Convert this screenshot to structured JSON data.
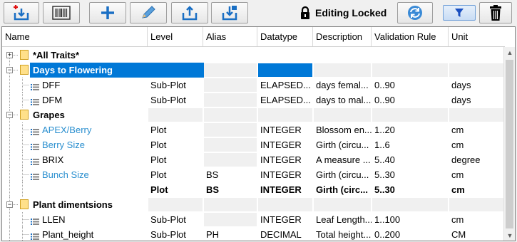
{
  "toolbar": {
    "buttons": [
      {
        "name": "import-button",
        "icon": "import-icon"
      },
      {
        "name": "barcode-button",
        "icon": "barcode-icon"
      },
      {
        "name": "add-button",
        "icon": "plus-icon"
      },
      {
        "name": "edit-button",
        "icon": "pencil-icon"
      },
      {
        "name": "export-button",
        "icon": "upload-icon"
      },
      {
        "name": "save-button",
        "icon": "save-icon"
      }
    ],
    "lock_label": "Editing Locked",
    "refresh_icon": "refresh-icon",
    "filter_icon": "filter-icon",
    "delete_icon": "trash-icon"
  },
  "columns": [
    "Name",
    "Level",
    "Alias",
    "Datatype",
    "Description",
    "Validation Rule",
    "Unit"
  ],
  "rows": [
    {
      "type": "folder",
      "name": "*All Traits*",
      "expander": "+",
      "level": "",
      "alias": "",
      "datatype": "",
      "description": "",
      "rule": "",
      "unit": ""
    },
    {
      "type": "folder",
      "name": "Days to Flowering",
      "expander": "−",
      "selected": true,
      "level": "",
      "alias": "",
      "datatype": "",
      "description": "",
      "rule": "",
      "unit": ""
    },
    {
      "type": "trait",
      "name": "DFF",
      "level": "Sub-Plot",
      "alias": "",
      "datatype": "ELAPSED...",
      "description": "days femal...",
      "rule": "0..90",
      "unit": "days"
    },
    {
      "type": "trait",
      "name": "DFM",
      "level": "Sub-Plot",
      "alias": "",
      "datatype": "ELAPSED...",
      "description": "days to mal...",
      "rule": "0..90",
      "unit": "days"
    },
    {
      "type": "folder",
      "name": "Grapes",
      "expander": "−",
      "level": "",
      "alias": "",
      "datatype": "",
      "description": "",
      "rule": "",
      "unit": ""
    },
    {
      "type": "trait",
      "name": "APEX/Berry",
      "link": true,
      "level": "Plot",
      "alias": "",
      "datatype": "INTEGER",
      "description": "Blossom en...",
      "rule": "1..20",
      "unit": "cm"
    },
    {
      "type": "trait",
      "name": "Berry Size",
      "link": true,
      "level": "Plot",
      "alias": "",
      "datatype": "INTEGER",
      "description": "Girth (circu...",
      "rule": "1..6",
      "unit": "cm"
    },
    {
      "type": "trait",
      "name": "BRIX",
      "level": "Plot",
      "alias": "",
      "datatype": "INTEGER",
      "description": "A measure ...",
      "rule": "5..40",
      "unit": "degree"
    },
    {
      "type": "trait",
      "name": "Bunch Size",
      "link": true,
      "level": "Plot",
      "alias": "BS",
      "datatype": "INTEGER",
      "description": "Girth (circu...",
      "rule": "5..30",
      "unit": "cm"
    },
    {
      "type": "child",
      "name": "",
      "level": "Plot",
      "alias": "BS",
      "datatype": "INTEGER",
      "description": "Girth (circ...",
      "rule": "5..30",
      "unit": "cm",
      "bold": true
    },
    {
      "type": "folder",
      "name": "Plant dimentsions",
      "expander": "−",
      "level": "",
      "alias": "",
      "datatype": "",
      "description": "",
      "rule": "",
      "unit": ""
    },
    {
      "type": "trait",
      "name": "LLEN",
      "level": "Sub-Plot",
      "alias": "",
      "datatype": "INTEGER",
      "description": "Leaf Length...",
      "rule": "1..100",
      "unit": "cm"
    },
    {
      "type": "trait",
      "name": "Plant_height",
      "level": "Sub-Plot",
      "alias": "PH",
      "datatype": "DECIMAL",
      "description": "Total height...",
      "rule": "0..200",
      "unit": "CM"
    }
  ],
  "colors": {
    "selection": "#0078d7",
    "link": "#2a8fcf",
    "folder": "#ffe08a"
  }
}
